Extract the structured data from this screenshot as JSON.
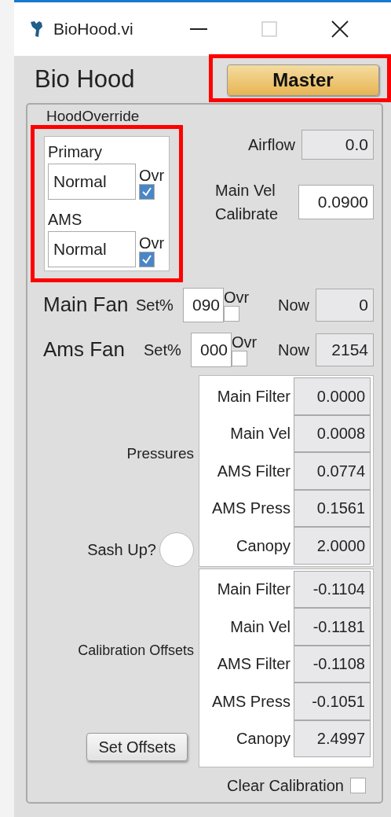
{
  "window": {
    "title": "BioHood.vi"
  },
  "header": {
    "title": "Bio Hood",
    "master_button": {
      "label": "Master",
      "highlighted": true
    }
  },
  "hood_override": {
    "label": "HoodOverride",
    "highlighted": true,
    "items": [
      {
        "label": "Primary",
        "value": "Normal",
        "ovr_label": "Ovr",
        "checked": true
      },
      {
        "label": "AMS",
        "value": "Normal",
        "ovr_label": "Ovr",
        "checked": true
      }
    ]
  },
  "airflow": {
    "label": "Airflow",
    "value": "0.0"
  },
  "main_vel_calibrate": {
    "label": "Main Vel Calibrate",
    "value": "0.0900"
  },
  "fans": [
    {
      "name": "Main Fan",
      "set_label": "Set%",
      "set_value": "090",
      "ovr_label": "Ovr",
      "checked": false,
      "now_label": "Now",
      "now_value": "0"
    },
    {
      "name": "Ams Fan",
      "set_label": "Set%",
      "set_value": "000",
      "ovr_label": "Ovr",
      "checked": false,
      "now_label": "Now",
      "now_value": "2154"
    }
  ],
  "pressures": {
    "label": "Pressures",
    "rows": [
      {
        "name": "Main Filter",
        "value": "0.0000"
      },
      {
        "name": "Main Vel",
        "value": "0.0008"
      },
      {
        "name": "AMS Filter",
        "value": "0.0774"
      },
      {
        "name": "AMS Press",
        "value": "0.1561"
      },
      {
        "name": "Canopy",
        "value": "2.0000"
      }
    ]
  },
  "sash": {
    "label": "Sash Up?",
    "on": false
  },
  "calibration_offsets": {
    "label": "Calibration Offsets",
    "rows": [
      {
        "name": "Main Filter",
        "value": "-0.1104"
      },
      {
        "name": "Main Vel",
        "value": "-0.1181"
      },
      {
        "name": "AMS Filter",
        "value": "-0.1108"
      },
      {
        "name": "AMS Press",
        "value": "-0.1051"
      },
      {
        "name": "Canopy",
        "value": "2.4997"
      }
    ]
  },
  "set_offsets_button": {
    "label": "Set Offsets"
  },
  "clear_calibration": {
    "label": "Clear Calibration",
    "checked": false
  }
}
